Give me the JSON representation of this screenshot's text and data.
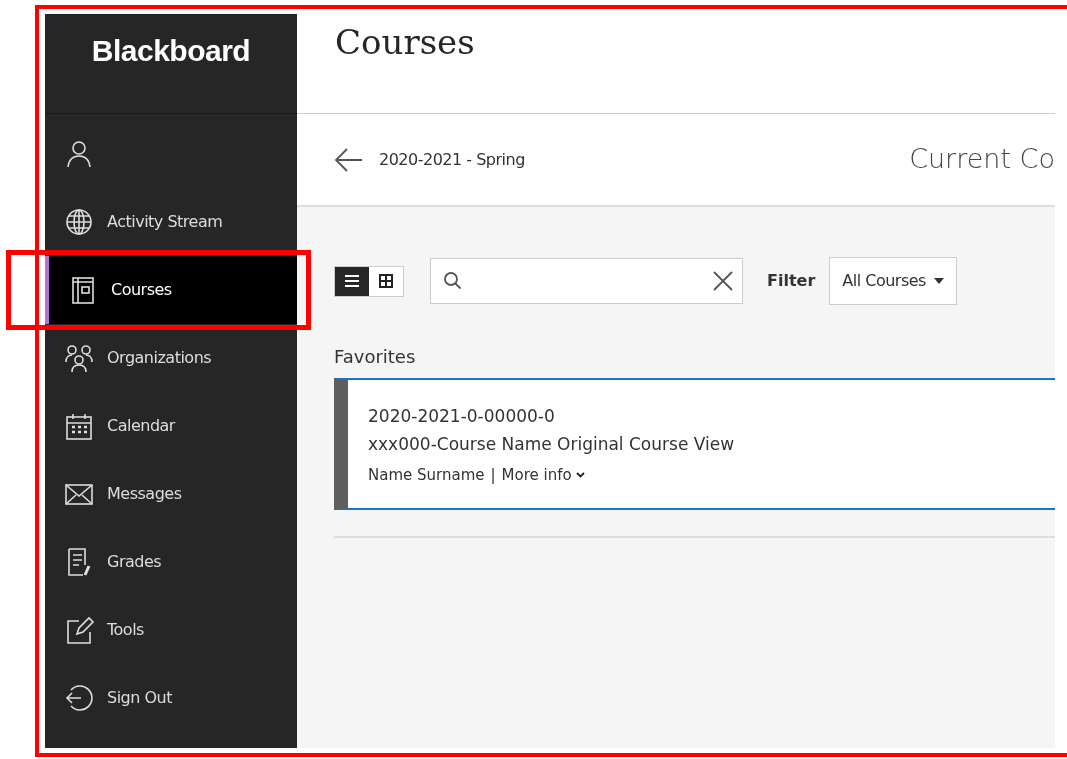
{
  "annotation_frame": true,
  "sidebar": {
    "logo": "Blackboard",
    "items": [
      {
        "kind": "profile",
        "selected": false,
        "outlined": false
      },
      {
        "kind": "globe",
        "label": "Activity Stream",
        "selected": false,
        "outlined": false
      },
      {
        "kind": "courses",
        "label": "Courses",
        "selected": true,
        "outlined": true
      },
      {
        "kind": "organizations",
        "label": "Organizations",
        "selected": false,
        "outlined": false
      },
      {
        "kind": "calendar",
        "label": "Calendar",
        "selected": false,
        "outlined": false
      },
      {
        "kind": "messages",
        "label": "Messages",
        "selected": false,
        "outlined": false
      },
      {
        "kind": "grades",
        "label": "Grades",
        "selected": false,
        "outlined": false
      },
      {
        "kind": "tools",
        "label": "Tools",
        "selected": false,
        "outlined": false
      },
      {
        "kind": "signout",
        "label": "Sign Out",
        "selected": false,
        "outlined": false
      }
    ]
  },
  "main": {
    "title": "Courses",
    "breadcrumb": {
      "term": "2020-2021 - Spring",
      "heading": "Current Co"
    },
    "view_toggle": [
      {
        "kind": "list",
        "selected": true
      },
      {
        "kind": "grid",
        "selected": false
      }
    ],
    "filter": {
      "label": "Filter",
      "value": "All Courses"
    },
    "sections": [
      {
        "title": "Favorites",
        "courses": [
          {
            "code": "2020-2021-0-00000-0",
            "name": "xxx000-Course Name Original Course View",
            "instructor": "Name Surname",
            "separator": "|",
            "more": "More info"
          }
        ]
      }
    ]
  }
}
